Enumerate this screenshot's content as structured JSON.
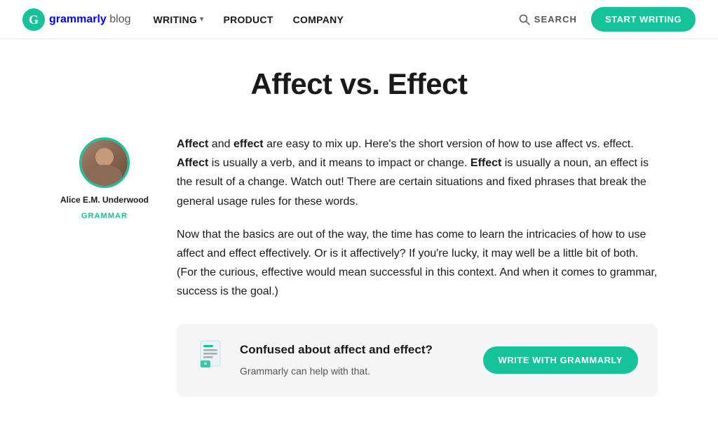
{
  "header": {
    "logo_text_grammarly": "grammarly",
    "logo_text_blog": " blog",
    "nav_items": [
      {
        "label": "WRITING",
        "has_chevron": true
      },
      {
        "label": "PRODUCT",
        "has_chevron": false
      },
      {
        "label": "COMPANY",
        "has_chevron": false
      }
    ],
    "search_label": "SEARCH",
    "start_writing_label": "START WRITING"
  },
  "article": {
    "title": "Affect vs. Effect",
    "author_name": "Alice E.M. Underwood",
    "author_category": "GRAMMAR",
    "paragraph1": "are easy to mix up. Here's the short version of how to use affect vs. effect. ",
    "paragraph1_b1": "Affect",
    "paragraph1_mid1": " and ",
    "paragraph1_b2": "effect",
    "paragraph1_b3": "Affect",
    "paragraph1_mid2": " is usually a verb, and it means to impact or change. ",
    "paragraph1_b4": "Effect",
    "paragraph1_end": " is usually a noun, an effect is the result of a change. Watch out! There are certain situations and fixed phrases that break the general usage rules for these words.",
    "paragraph2": "Now that the basics are out of the way, the time has come to learn the intricacies of how to use affect and effect effectively. Or is it affectively? If you're lucky, it may well be a little bit of both. (For the curious, effective would mean successful in this context. And when it comes to grammar, success is the goal.)"
  },
  "cta": {
    "title": "Confused about affect and effect?",
    "subtitle": "Grammarly can help with that.",
    "button_label": "WRITE WITH GRAMMARLY"
  }
}
